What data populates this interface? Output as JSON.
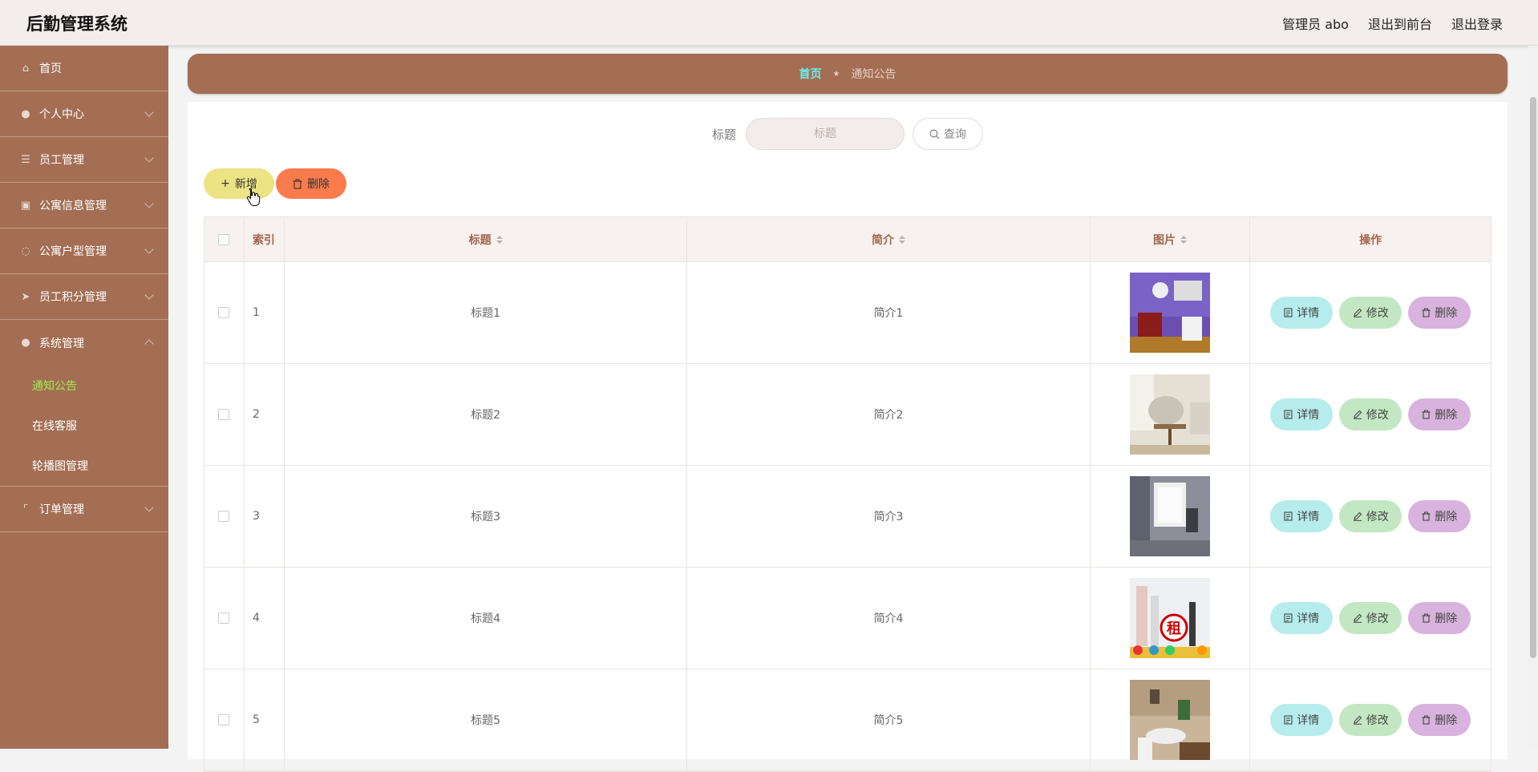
{
  "header": {
    "title": "后勤管理系统",
    "links": [
      "管理员 abo",
      "退出到前台",
      "退出登录"
    ]
  },
  "sidebar": {
    "items": [
      {
        "label": "首页",
        "icon": "home-icon",
        "glyph": "⌂"
      },
      {
        "label": "个人中心",
        "icon": "user-icon",
        "glyph": "●"
      },
      {
        "label": "员工管理",
        "icon": "list-icon",
        "glyph": "☰"
      },
      {
        "label": "公寓信息管理",
        "icon": "clipboard-icon",
        "glyph": "▣"
      },
      {
        "label": "公寓户型管理",
        "icon": "circle-icon",
        "glyph": "◌"
      },
      {
        "label": "员工积分管理",
        "icon": "send-icon",
        "glyph": "➤"
      },
      {
        "label": "系统管理",
        "icon": "user-icon",
        "glyph": "●"
      }
    ],
    "sub_items": [
      "通知公告",
      "在线客服",
      "轮播图管理"
    ],
    "last_item": {
      "label": "订单管理",
      "icon": "bracket-icon",
      "glyph": "⌜"
    }
  },
  "breadcrumb": {
    "home": "首页",
    "current": "通知公告"
  },
  "search": {
    "label": "标题",
    "placeholder": "标题",
    "button": "查询"
  },
  "actions": {
    "add": "新增",
    "delete": "删除"
  },
  "table": {
    "headers": [
      "索引",
      "标题",
      "简介",
      "图片",
      "操作"
    ],
    "rows": [
      {
        "index": "1",
        "title": "标题1",
        "intro": "简介1"
      },
      {
        "index": "2",
        "title": "标题2",
        "intro": "简介2"
      },
      {
        "index": "3",
        "title": "标题3",
        "intro": "简介3"
      },
      {
        "index": "4",
        "title": "标题4",
        "intro": "简介4"
      },
      {
        "index": "5",
        "title": "标题5",
        "intro": "简介5"
      }
    ],
    "row_actions": {
      "detail": "详情",
      "edit": "修改",
      "remove": "删除"
    }
  },
  "colors": {
    "accent": "#a36e53",
    "active": "#9ef04a",
    "crumb_home": "#6ff0f0"
  }
}
